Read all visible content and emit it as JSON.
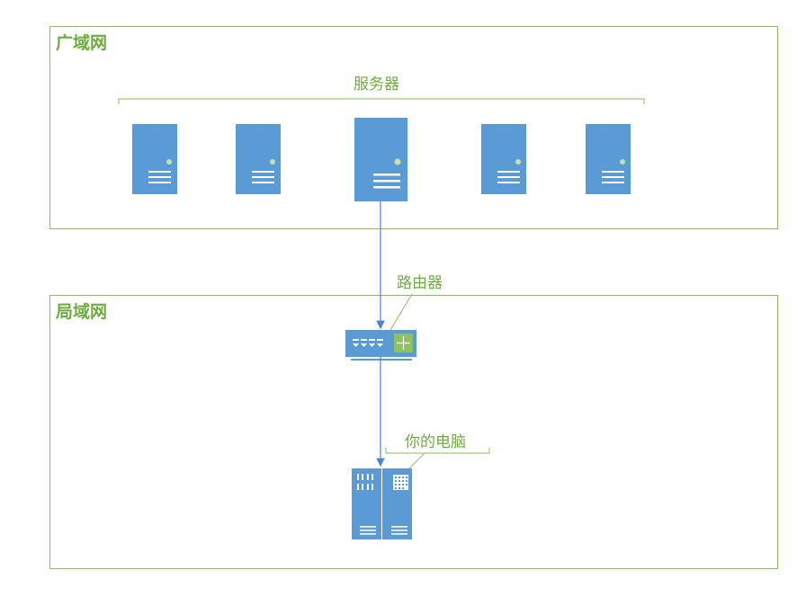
{
  "wan": {
    "title": "广域网"
  },
  "lan": {
    "title": "局域网"
  },
  "servers": {
    "label": "服务器",
    "count": 5
  },
  "router": {
    "label": "路由器"
  },
  "computer": {
    "label": "你的电脑"
  },
  "colors": {
    "green": "#6fac3f",
    "border": "#8dbb62",
    "blue": "#5b9bd5",
    "dark_blue": "#4a86c8",
    "white": "#ffffff"
  }
}
